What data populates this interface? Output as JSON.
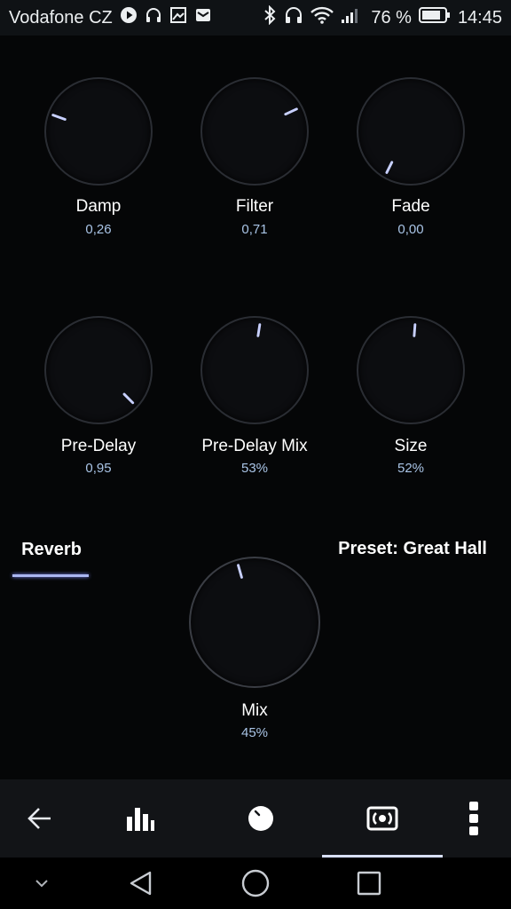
{
  "status_bar": {
    "carrier": "Vodafone CZ",
    "battery_percent": "76 %",
    "time": "14:45",
    "icons_left": [
      "play-icon",
      "headphones-icon",
      "image-icon",
      "mail-icon"
    ],
    "icons_right": [
      "bluetooth-icon",
      "headphones-icon",
      "wifi-icon",
      "signal-icon",
      "battery-icon"
    ]
  },
  "knobs": [
    {
      "label": "Damp",
      "value": "0,26"
    },
    {
      "label": "Filter",
      "value": "0,71"
    },
    {
      "label": "Fade",
      "value": "0,00"
    },
    {
      "label": "Pre-Delay",
      "value": "0,95"
    },
    {
      "label": "Pre-Delay Mix",
      "value": "53%"
    },
    {
      "label": "Size",
      "value": "52%"
    },
    {
      "label": "Mix",
      "value": "45%"
    }
  ],
  "tab": {
    "label": "Reverb"
  },
  "preset": {
    "label": "Preset: Great Hall"
  },
  "app_bar": {
    "buttons": [
      "back-arrow-icon",
      "equalizer-icon",
      "knob-icon",
      "surround-icon",
      "more-vertical-icon"
    ],
    "active": "surround-icon"
  },
  "nav_bar": {
    "buttons": [
      "chevron-down-icon",
      "back-triangle-icon",
      "home-circle-icon",
      "recents-square-icon"
    ]
  },
  "colors": {
    "background": "#050607",
    "indicator": "#c8d0ff",
    "value_text": "#a9c4e6",
    "knob_border": "#2a2d33"
  }
}
